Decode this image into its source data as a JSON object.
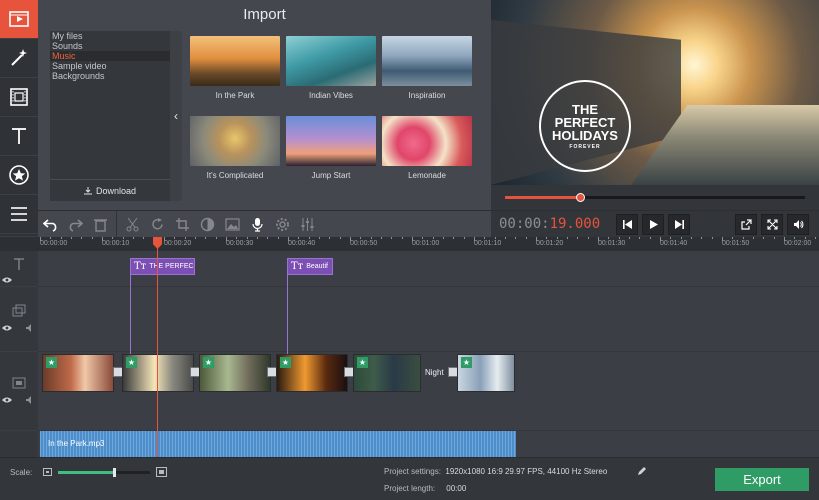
{
  "import": {
    "title": "Import",
    "categories": [
      "My files",
      "Sounds",
      "Music",
      "Sample video",
      "Backgrounds"
    ],
    "selected_category": "Music",
    "download_label": "Download",
    "items": [
      {
        "label": "In the Park"
      },
      {
        "label": "Indian Vibes"
      },
      {
        "label": "Inspiration"
      },
      {
        "label": "It's Complicated"
      },
      {
        "label": "Jump Start"
      },
      {
        "label": "Lemonade"
      }
    ]
  },
  "preview": {
    "overlay_lines": [
      "THE",
      "PERFECT",
      "HOLIDAYS"
    ],
    "overlay_small": "FOREVER",
    "progress": 0.25
  },
  "transport": {
    "time_prefix": "00:00:",
    "time_current": "19.000"
  },
  "timeline": {
    "ticks": [
      "00:00:00",
      "00:00:10",
      "00:00:20",
      "00:00:30",
      "00:00:40",
      "00:00:50",
      "00:01:00",
      "00:01:10",
      "00:01:20",
      "00:01:30",
      "00:01:40",
      "00:01:50",
      "00:02:00"
    ],
    "title_clips": [
      {
        "label": "THE PERFEC"
      },
      {
        "label": "Beautif"
      }
    ],
    "video_label": "Night",
    "audio_label": "In the Park.mp3"
  },
  "bottom": {
    "scale_label": "Scale:",
    "scale_value": 0.61,
    "settings_label": "Project settings:",
    "settings_value": "1920x1080 16:9 29.97 FPS, 44100 Hz Stereo",
    "length_label": "Project length:",
    "length_value": "00:00",
    "export_label": "Export"
  },
  "colors": {
    "accent": "#e8533b",
    "export": "#2f9c66",
    "title_clip": "#7b4fb3",
    "audio": "#4c8cc9"
  }
}
